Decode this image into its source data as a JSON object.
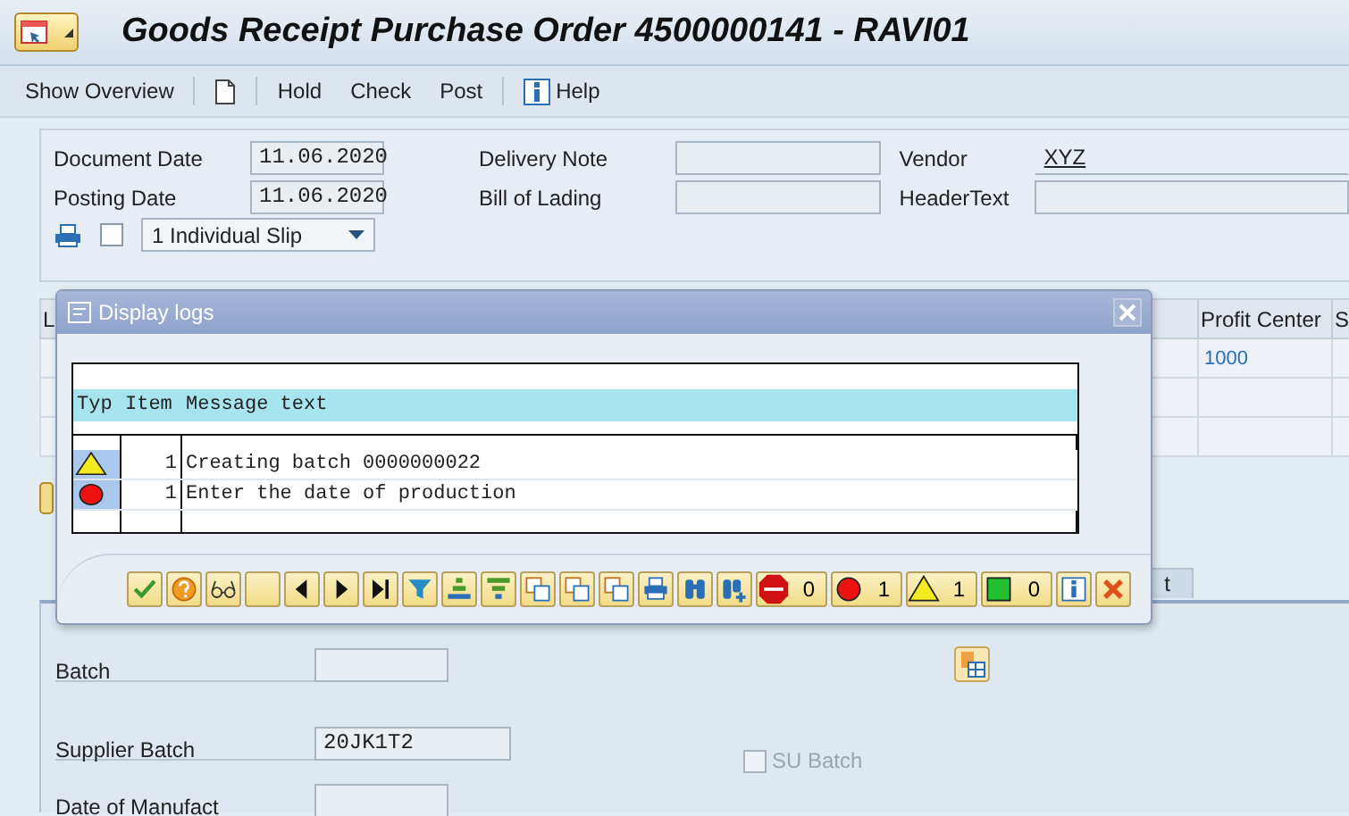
{
  "window": {
    "title": "Goods Receipt Purchase Order 4500000141 - RAVI01"
  },
  "toolbar": {
    "groups": [
      [
        {
          "kind": "text",
          "label": "Show Overview"
        }
      ],
      [
        {
          "kind": "document"
        }
      ],
      [
        {
          "kind": "text",
          "label": "Hold"
        },
        {
          "kind": "text",
          "label": "Check"
        },
        {
          "kind": "text",
          "label": "Post"
        }
      ],
      [
        {
          "kind": "info",
          "label": "Help"
        }
      ]
    ]
  },
  "header": {
    "fields": [
      {
        "label": "Document Date",
        "value": "11.06.2020"
      },
      {
        "label": "Delivery Note"
      },
      {
        "label": "Vendor",
        "value": "XYZ",
        "link": true
      },
      {
        "label": "Posting Date",
        "value": "11.06.2020"
      },
      {
        "label": "Bill of Lading"
      },
      {
        "label": "HeaderText"
      }
    ],
    "print": {
      "checked": false,
      "slip": "1 Individual Slip"
    }
  },
  "items_table": {
    "columns": [
      "L",
      "Profit Center",
      "S"
    ],
    "rows": [
      {
        "column_2": "1000"
      },
      {},
      {}
    ]
  },
  "detail": {
    "tabs": [
      {
        "label": "t",
        "selected": false
      }
    ],
    "fields": [
      {
        "label": "Batch"
      },
      {
        "label": "Supplier Batch",
        "value": "20JK1T2"
      },
      {
        "label": "Date of Manufact"
      }
    ],
    "su_batch": {
      "label": "SU Batch",
      "checked": false,
      "disabled": true
    }
  },
  "dialog": {
    "title": "Display logs",
    "columns": [
      "Typ",
      "Item",
      "Message text"
    ],
    "messages": [
      {
        "kind": "warning",
        "item": "1",
        "text": "Creating batch 0000000022"
      },
      {
        "kind": "error",
        "item": "1",
        "text": "Enter the date of production"
      }
    ],
    "tools": [
      {
        "kind": "ok"
      },
      {
        "kind": "help"
      },
      {
        "kind": "glasses"
      },
      {
        "kind": "blank"
      },
      {
        "kind": "previous"
      },
      {
        "kind": "next"
      },
      {
        "kind": "last"
      },
      {
        "kind": "filter"
      },
      {
        "kind": "sort-ascending"
      },
      {
        "kind": "sort-descending"
      },
      {
        "kind": "copy"
      },
      {
        "kind": "copy"
      },
      {
        "kind": "copy"
      },
      {
        "kind": "print"
      },
      {
        "kind": "find"
      },
      {
        "kind": "find-next"
      }
    ],
    "counters": [
      {
        "kind": "stop",
        "count": "0"
      },
      {
        "kind": "error",
        "count": "1"
      },
      {
        "kind": "warning",
        "count": "1"
      },
      {
        "kind": "success",
        "count": "0"
      }
    ],
    "end_tools": [
      {
        "kind": "info"
      },
      {
        "kind": "cancel"
      }
    ]
  }
}
